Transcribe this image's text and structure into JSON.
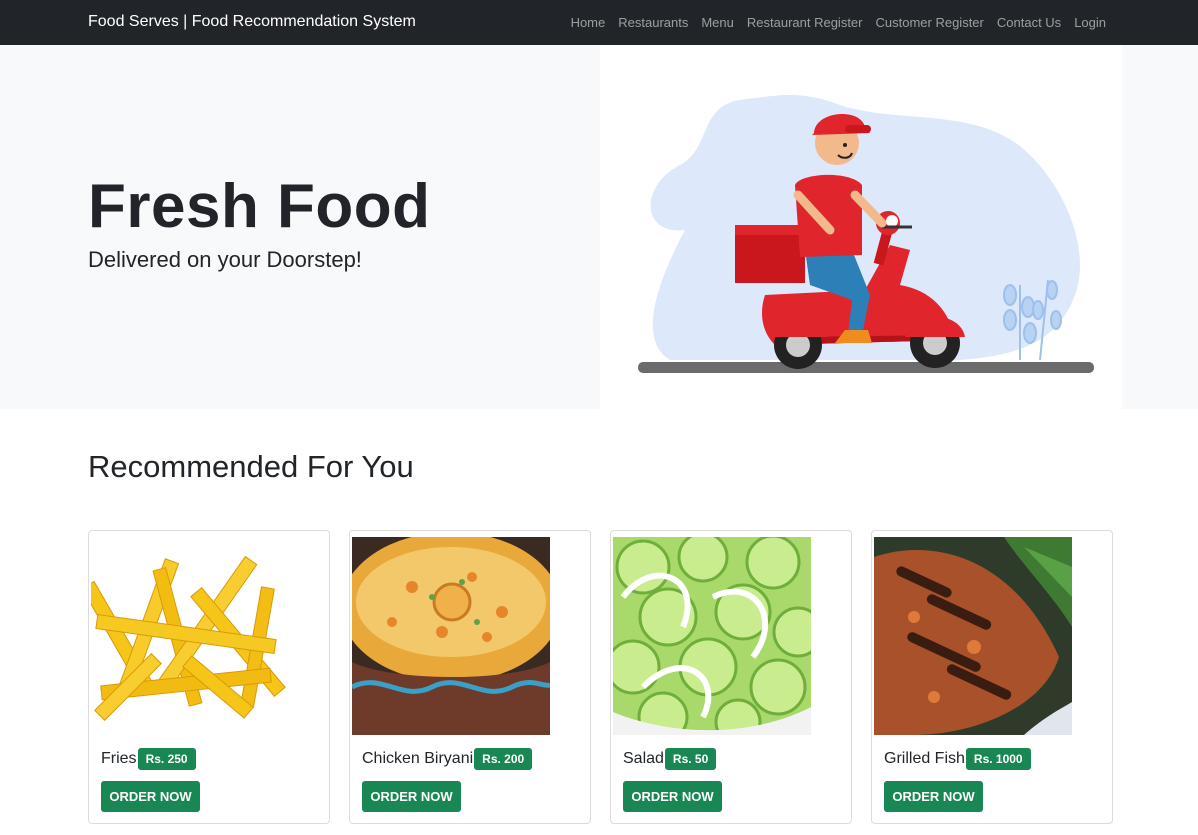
{
  "navbar": {
    "brand": "Food Serves | Food Recommendation System",
    "links": [
      "Home",
      "Restaurants",
      "Menu",
      "Restaurant Register",
      "Customer Register",
      "Contact Us",
      "Login"
    ]
  },
  "hero": {
    "title": "Fresh Food",
    "subtitle": "Delivered on your Doorstep!",
    "illustration": "delivery-scooter-illustration"
  },
  "recommended": {
    "title": "Recommended For You",
    "items": [
      {
        "name": "Fries",
        "price": "Rs. 250",
        "button": "ORDER NOW",
        "image": "fries-photo"
      },
      {
        "name": "Chicken Biryani",
        "price": "Rs. 200",
        "button": "ORDER NOW",
        "image": "biryani-photo"
      },
      {
        "name": "Salad",
        "price": "Rs. 50",
        "button": "ORDER NOW",
        "image": "salad-photo"
      },
      {
        "name": "Grilled Fish",
        "price": "Rs. 1000",
        "button": "ORDER NOW",
        "image": "grilled-fish-photo"
      }
    ]
  },
  "colors": {
    "navbar": "#212529",
    "hero_bg": "#f8f9fa",
    "accent_green": "#198754"
  }
}
